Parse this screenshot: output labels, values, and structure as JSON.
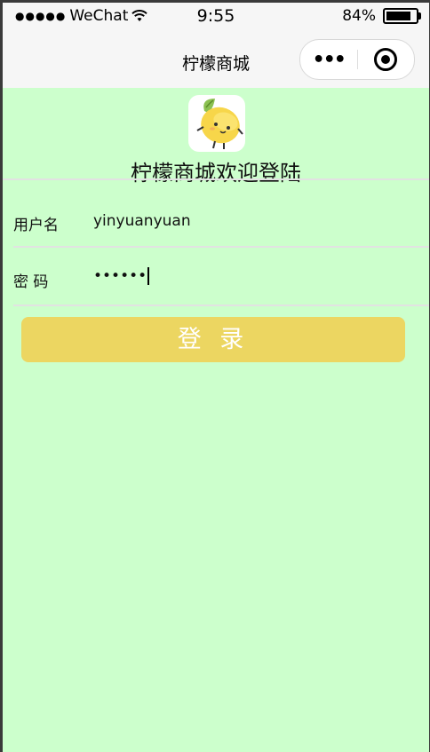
{
  "status_bar": {
    "signal": "●●●●●",
    "carrier": "WeChat",
    "time": "9:55",
    "battery_text": "84%",
    "battery_level": 0.84
  },
  "nav": {
    "title": "柠檬商城",
    "more_icon": "•••",
    "target_icon": "record-target-icon"
  },
  "header": {
    "logo": "lemon-mascot-logo",
    "welcome": "柠檬商城欢迎登陆"
  },
  "form": {
    "username_label": "用户名",
    "username_value": "yinyuanyuan",
    "password_label": "密 码",
    "password_value": "••••••"
  },
  "login_button": "登 录",
  "colors": {
    "background": "#ccffcc",
    "button": "#ecd661",
    "lemon": "#f7d64a"
  }
}
